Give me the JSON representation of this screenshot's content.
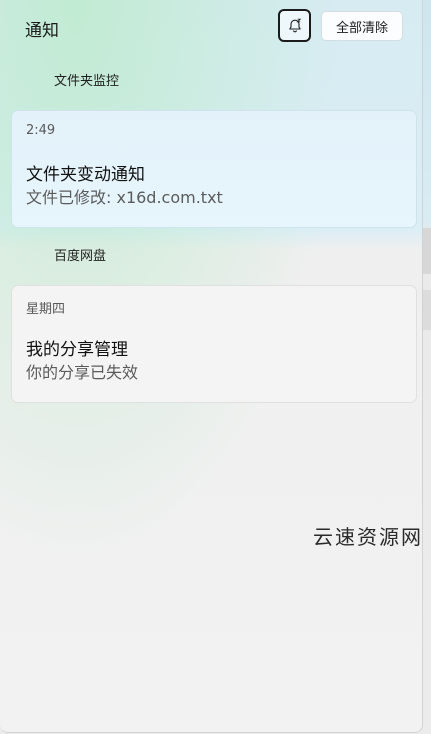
{
  "panel": {
    "title": "通知",
    "dnd_button_icon": "bell-snooze-icon",
    "clear_all_label": "全部清除"
  },
  "groups": [
    {
      "app_name": "文件夹监控",
      "app_icon": "folder-monitor-icon",
      "notification": {
        "time": "2:49",
        "title": "文件夹变动通知",
        "body": "文件已修改: x16d.com.txt"
      }
    },
    {
      "app_name": "百度网盘",
      "app_icon": "baidu-netdisk-icon",
      "notification": {
        "time": "星期四",
        "title": "我的分享管理",
        "body": "你的分享已失效"
      }
    }
  ],
  "watermark": "云速资源网",
  "colors": {
    "accent_blue_card": "#e3f2fa",
    "grey_card": "#f4f4f4"
  }
}
